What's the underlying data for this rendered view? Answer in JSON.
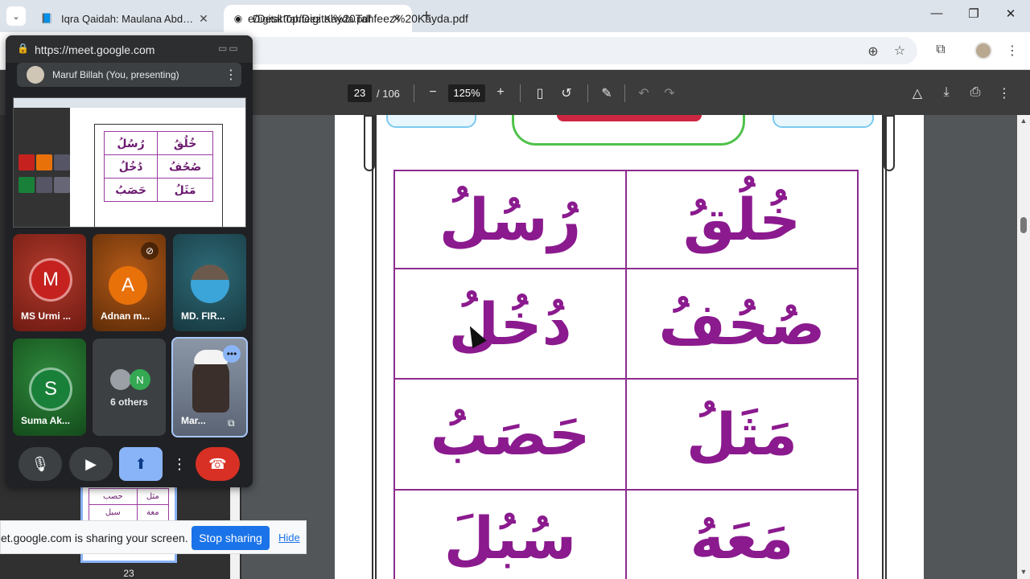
{
  "browser": {
    "tabs": [
      {
        "title": "Iqra Qaidah: Maulana Abdus Sa",
        "active": false
      },
      {
        "title": "Digital Tahfeez Kayda.pdf",
        "active": true
      }
    ],
    "url": "e/Desktop/Digital%20Tahfeez%20Kayda.pdf"
  },
  "pdf": {
    "page_current": "23",
    "page_total": "/ 106",
    "zoom": "125%",
    "thumb_page": "23",
    "thumb_cells": [
      [
        "رُسُلُ",
        "خُلُقُ"
      ],
      [
        "دُخُلُ",
        "صُحُفُ"
      ],
      [
        "حَصَبُ",
        "مَثَلُ"
      ]
    ],
    "thumb_bottom": [
      [
        "حصب",
        "مثل"
      ],
      [
        "سبل",
        "معة"
      ]
    ],
    "cells": [
      [
        "رُسُلُ",
        "خُلُقُ"
      ],
      [
        "دُخُلُ",
        "صُحُفُ"
      ],
      [
        "حَصَبُ",
        "مَثَلُ"
      ],
      [
        "سُبُلَ",
        "مَعَهُ"
      ]
    ]
  },
  "meet": {
    "url": "https://meet.google.com",
    "presenter": "Maruf Billah (You, presenting)",
    "participants": [
      {
        "name": "MS Urmi ...",
        "initial": "M",
        "color": "#c5221f"
      },
      {
        "name": "Adnan m...",
        "initial": "A",
        "color": "#e8710a"
      },
      {
        "name": "MD. FIR...",
        "initial": ""
      },
      {
        "name": "Suma Ak...",
        "initial": "S",
        "color": "#188038"
      },
      {
        "name": "6 others",
        "initial": "N"
      },
      {
        "name": "Mar...",
        "initial": ""
      }
    ]
  },
  "sharing": {
    "message": "et.google.com is sharing your screen.",
    "stop_label": "Stop sharing",
    "hide_label": "Hide"
  }
}
